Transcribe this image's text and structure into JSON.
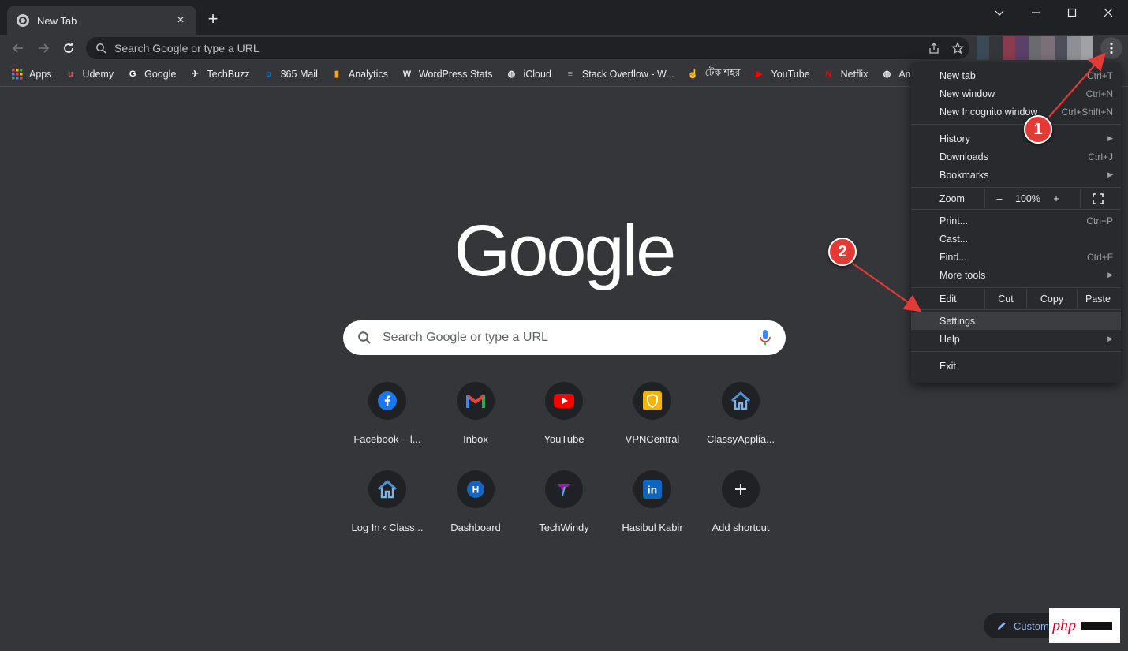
{
  "window": {
    "tab_title": "New Tab",
    "tab_close": "×",
    "new_tab": "+"
  },
  "toolbar": {
    "omnibox_placeholder": "Search Google or type a URL"
  },
  "bookmarks": [
    {
      "label": "Apps",
      "icon": "apps-grid-icon"
    },
    {
      "label": "Udemy",
      "icon": "udemy-icon",
      "glyph": "u",
      "color": "#ec5252"
    },
    {
      "label": "Google",
      "icon": "google-icon",
      "glyph": "G",
      "color": "#ffffff"
    },
    {
      "label": "TechBuzz",
      "icon": "techbuzz-icon",
      "glyph": "✈",
      "color": "#e8eaed"
    },
    {
      "label": "365 Mail",
      "icon": "outlook-icon",
      "glyph": "o",
      "color": "#0078d4"
    },
    {
      "label": "Analytics",
      "icon": "analytics-icon",
      "glyph": "▮",
      "color": "#f9ab00"
    },
    {
      "label": "WordPress Stats",
      "icon": "wordpress-icon",
      "glyph": "W",
      "color": "#e8eaed"
    },
    {
      "label": "iCloud",
      "icon": "globe-icon",
      "glyph": "◍",
      "color": "#e8eaed"
    },
    {
      "label": "Stack Overflow - W...",
      "icon": "stackoverflow-icon",
      "glyph": "≡",
      "color": "#f48024"
    },
    {
      "label": "টেক শহর",
      "icon": "tekshohor-icon",
      "glyph": "☝",
      "color": "#e8eaed"
    },
    {
      "label": "YouTube",
      "icon": "youtube-icon",
      "glyph": "▶",
      "color": "#ff0000"
    },
    {
      "label": "Netflix",
      "icon": "netflix-icon",
      "glyph": "N",
      "color": "#e50914"
    },
    {
      "label": "An ar",
      "icon": "globe-icon",
      "glyph": "◍",
      "color": "#e8eaed"
    }
  ],
  "search": {
    "placeholder": "Search Google or type a URL"
  },
  "logo": "Google",
  "shortcuts": [
    {
      "label": "Facebook – l...",
      "icon": "facebook-icon"
    },
    {
      "label": "Inbox",
      "icon": "gmail-icon"
    },
    {
      "label": "YouTube",
      "icon": "youtube-icon"
    },
    {
      "label": "VPNCentral",
      "icon": "shield-icon"
    },
    {
      "label": "ClassyAppliа...",
      "icon": "house-icon"
    },
    {
      "label": "Log In ‹ Class...",
      "icon": "house-icon"
    },
    {
      "label": "Dashboard",
      "icon": "dashboard-icon",
      "glyph": "H"
    },
    {
      "label": "TechWindy",
      "icon": "techwindy-icon",
      "glyph": "T"
    },
    {
      "label": "Hasibul Kabir",
      "icon": "linkedin-icon",
      "glyph": "in"
    },
    {
      "label": "Add shortcut",
      "icon": "plus-icon",
      "glyph": "+"
    }
  ],
  "menu": {
    "new_tab": {
      "label": "New tab",
      "shortcut": "Ctrl+T"
    },
    "new_window": {
      "label": "New window",
      "shortcut": "Ctrl+N"
    },
    "new_incognito": {
      "label": "New Incognito window",
      "shortcut": "Ctrl+Shift+N"
    },
    "history": {
      "label": "History"
    },
    "downloads": {
      "label": "Downloads",
      "shortcut": "Ctrl+J"
    },
    "bookmarks": {
      "label": "Bookmarks"
    },
    "zoom": {
      "label": "Zoom",
      "minus": "–",
      "value": "100%",
      "plus": "+"
    },
    "print": {
      "label": "Print...",
      "shortcut": "Ctrl+P"
    },
    "cast": {
      "label": "Cast..."
    },
    "find": {
      "label": "Find...",
      "shortcut": "Ctrl+F"
    },
    "more_tools": {
      "label": "More tools"
    },
    "edit": {
      "label": "Edit",
      "cut": "Cut",
      "copy": "Copy",
      "paste": "Paste"
    },
    "settings": {
      "label": "Settings"
    },
    "help": {
      "label": "Help"
    },
    "exit": {
      "label": "Exit"
    }
  },
  "annotations": {
    "badge1": "1",
    "badge2": "2",
    "color": "#e53935"
  },
  "customize": {
    "label": "Custom"
  },
  "watermark": {
    "text": "php"
  }
}
